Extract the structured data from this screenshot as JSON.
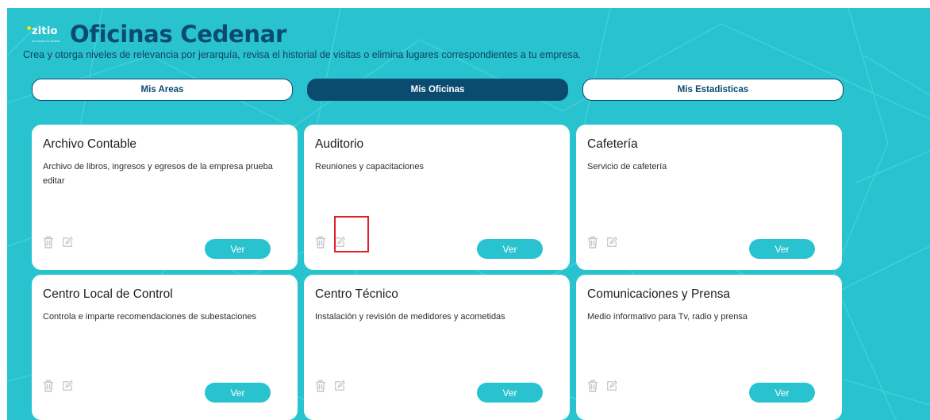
{
  "header": {
    "logo_text": "zitio",
    "logo_tagline": "encuentra tu destino",
    "title": "Oficinas Cedenar",
    "subtitle": "Crea y otorga niveles de relevancia por jerarquía, revisa el historial de visitas o elimina lugares correspondientes a tu empresa."
  },
  "tabs": [
    {
      "label": "Mis Areas",
      "active": false
    },
    {
      "label": "Mis Oficinas",
      "active": true
    },
    {
      "label": "Mis Estadisticas",
      "active": false
    }
  ],
  "cards": [
    {
      "title": "Archivo Contable",
      "description": "Archivo de libros, ingresos y egresos de la empresa prueba editar",
      "button": "Ver"
    },
    {
      "title": "Auditorio",
      "description": "Reuniones y capacitaciones",
      "button": "Ver"
    },
    {
      "title": "Cafetería",
      "description": "Servicio de cafetería",
      "button": "Ver"
    },
    {
      "title": "Centro Local de Control",
      "description": "Controla e imparte recomendaciones de subestaciones",
      "button": "Ver"
    },
    {
      "title": "Centro Técnico",
      "description": "Instalación y revisión de medidores y acometidas",
      "button": "Ver"
    },
    {
      "title": "Comunicaciones y Prensa",
      "description": "Medio informativo para Tv, radio y prensa",
      "button": "Ver"
    }
  ],
  "icons": {
    "delete": "trash-icon",
    "edit": "edit-icon"
  },
  "colors": {
    "background": "#29c3cf",
    "brand_dark": "#0b4b6f",
    "highlight": "#e11d25"
  }
}
